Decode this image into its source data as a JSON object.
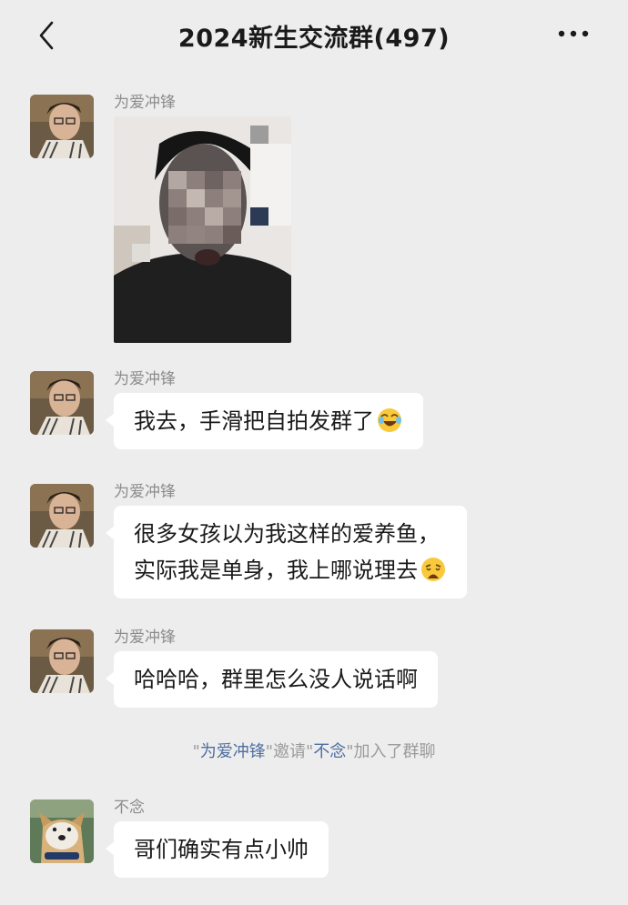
{
  "header": {
    "title": "2024新生交流群(497)"
  },
  "messages": [
    {
      "sender": "为爱冲锋",
      "type": "image",
      "image_label": "selfie-photo-pixelated"
    },
    {
      "sender": "为爱冲锋",
      "type": "text",
      "lines": [
        "我去，手滑把自拍发群了"
      ],
      "emoji": "rofl-emoji"
    },
    {
      "sender": "为爱冲锋",
      "type": "text",
      "lines": [
        "很多女孩以为我这样的爱养鱼，",
        "实际我是单身，我上哪说理去"
      ],
      "emoji": "weary-emoji"
    },
    {
      "sender": "为爱冲锋",
      "type": "text",
      "lines": [
        "哈哈哈，群里怎么没人说话啊"
      ]
    },
    {
      "sender": "不念",
      "type": "text",
      "lines": [
        "哥们确实有点小帅"
      ]
    }
  ],
  "system_notice": {
    "quote_open": "\"",
    "inviter": "为爱冲锋",
    "quote_close_1": "\"邀请\"",
    "invitee": "不念",
    "suffix": "\"加入了群聊"
  },
  "colors": {
    "background": "#ededed",
    "bubble": "#ffffff",
    "link": "#4f6ea0",
    "muted_text": "#8c8c8c"
  }
}
